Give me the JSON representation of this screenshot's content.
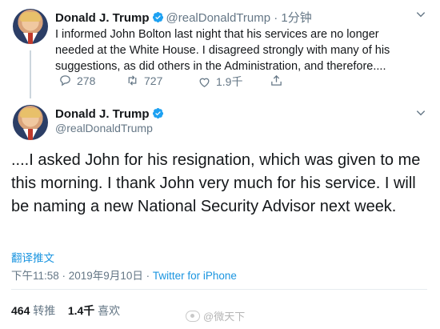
{
  "tweet1": {
    "name": "Donald J. Trump",
    "handle": "@realDonaldTrump",
    "separator": "·",
    "time": "1分钟",
    "text": "I informed John Bolton last night that his services are no longer needed at the White House. I disagreed strongly with many of his suggestions, as did others in the Administration, and therefore....",
    "replies": "278",
    "retweets": "727",
    "likes": "1.9千"
  },
  "tweet2": {
    "name": "Donald J. Trump",
    "handle": "@realDonaldTrump",
    "text": "....I asked John for his resignation, which was given to me this morning. I thank John very much for his service. I will be naming a new National Security Advisor next week.",
    "translate": "翻译推文",
    "datetime": "下午11:58 · 2019年9月10日 · ",
    "client": "Twitter for iPhone",
    "retweet_count": "464",
    "retweet_label": "转推",
    "like_count": "1.4千",
    "like_label": "喜欢"
  },
  "watermark": "@微天下",
  "colors": {
    "accent": "#1b95e0",
    "muted": "#657786",
    "verified": "#1da1f2"
  }
}
